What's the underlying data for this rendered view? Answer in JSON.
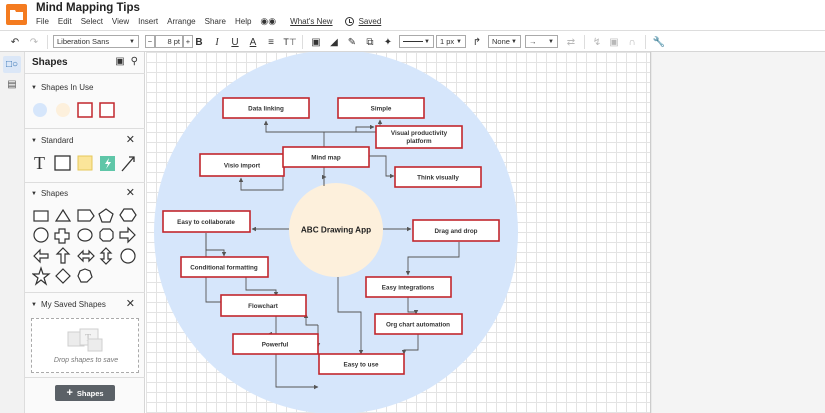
{
  "document": {
    "title": "Mind Mapping Tips"
  },
  "menu": {
    "items": [
      "File",
      "Edit",
      "Select",
      "View",
      "Insert",
      "Arrange",
      "Share",
      "Help"
    ],
    "whats_new": "What's New",
    "saved": "Saved"
  },
  "toolbar": {
    "font_family": "Liberation Sans",
    "font_size": "8 pt",
    "minus": "−",
    "plus": "+",
    "line_width": "1 px",
    "line_start": "None"
  },
  "panel": {
    "title": "Shapes",
    "sections": {
      "in_use": "Shapes In Use",
      "standard": "Standard",
      "shapes": "Shapes",
      "saved": "My Saved Shapes"
    },
    "drop_hint": "Drop shapes to save",
    "add_button": "Shapes"
  },
  "diagram": {
    "center": "ABC Drawing App",
    "nodes": {
      "data_linking": "Data linking",
      "simple": "Simple",
      "visual_productivity_1": "Visual productivity",
      "visual_productivity_2": "platform",
      "visio_import": "Visio import",
      "mind_map": "Mind map",
      "think_visually": "Think visually",
      "easy_to_collaborate": "Easy to collaborate",
      "drag_and_drop": "Drag and drop",
      "conditional_formatting": "Conditional formatting",
      "easy_integrations": "Easy integrations",
      "flowchart": "Flowchart",
      "org_chart_automation": "Org chart automation",
      "powerful": "Powerful",
      "easy_to_use": "Easy to use"
    },
    "colors": {
      "outer_circle": "#d6e6fb",
      "center_circle": "#fdf0dc",
      "node_border": "#c1272d",
      "connector": "#555555"
    }
  }
}
